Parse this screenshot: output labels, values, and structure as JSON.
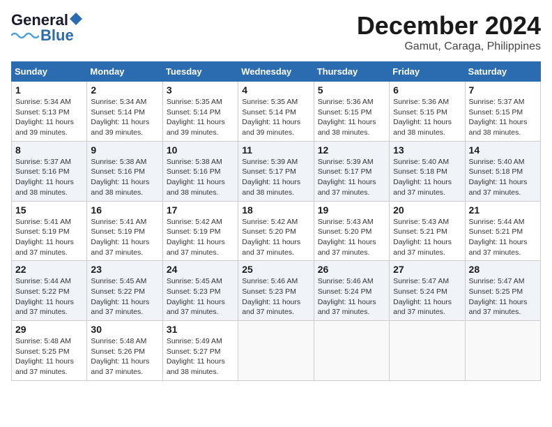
{
  "logo": {
    "line1": "General",
    "line2": "Blue"
  },
  "header": {
    "month": "December 2024",
    "location": "Gamut, Caraga, Philippines"
  },
  "columns": [
    "Sunday",
    "Monday",
    "Tuesday",
    "Wednesday",
    "Thursday",
    "Friday",
    "Saturday"
  ],
  "weeks": [
    [
      {
        "day": "1",
        "sunrise": "5:34 AM",
        "sunset": "5:13 PM",
        "daylight": "11 hours and 39 minutes."
      },
      {
        "day": "2",
        "sunrise": "5:34 AM",
        "sunset": "5:14 PM",
        "daylight": "11 hours and 39 minutes."
      },
      {
        "day": "3",
        "sunrise": "5:35 AM",
        "sunset": "5:14 PM",
        "daylight": "11 hours and 39 minutes."
      },
      {
        "day": "4",
        "sunrise": "5:35 AM",
        "sunset": "5:14 PM",
        "daylight": "11 hours and 39 minutes."
      },
      {
        "day": "5",
        "sunrise": "5:36 AM",
        "sunset": "5:15 PM",
        "daylight": "11 hours and 38 minutes."
      },
      {
        "day": "6",
        "sunrise": "5:36 AM",
        "sunset": "5:15 PM",
        "daylight": "11 hours and 38 minutes."
      },
      {
        "day": "7",
        "sunrise": "5:37 AM",
        "sunset": "5:15 PM",
        "daylight": "11 hours and 38 minutes."
      }
    ],
    [
      {
        "day": "8",
        "sunrise": "5:37 AM",
        "sunset": "5:16 PM",
        "daylight": "11 hours and 38 minutes."
      },
      {
        "day": "9",
        "sunrise": "5:38 AM",
        "sunset": "5:16 PM",
        "daylight": "11 hours and 38 minutes."
      },
      {
        "day": "10",
        "sunrise": "5:38 AM",
        "sunset": "5:16 PM",
        "daylight": "11 hours and 38 minutes."
      },
      {
        "day": "11",
        "sunrise": "5:39 AM",
        "sunset": "5:17 PM",
        "daylight": "11 hours and 38 minutes."
      },
      {
        "day": "12",
        "sunrise": "5:39 AM",
        "sunset": "5:17 PM",
        "daylight": "11 hours and 37 minutes."
      },
      {
        "day": "13",
        "sunrise": "5:40 AM",
        "sunset": "5:18 PM",
        "daylight": "11 hours and 37 minutes."
      },
      {
        "day": "14",
        "sunrise": "5:40 AM",
        "sunset": "5:18 PM",
        "daylight": "11 hours and 37 minutes."
      }
    ],
    [
      {
        "day": "15",
        "sunrise": "5:41 AM",
        "sunset": "5:19 PM",
        "daylight": "11 hours and 37 minutes."
      },
      {
        "day": "16",
        "sunrise": "5:41 AM",
        "sunset": "5:19 PM",
        "daylight": "11 hours and 37 minutes."
      },
      {
        "day": "17",
        "sunrise": "5:42 AM",
        "sunset": "5:19 PM",
        "daylight": "11 hours and 37 minutes."
      },
      {
        "day": "18",
        "sunrise": "5:42 AM",
        "sunset": "5:20 PM",
        "daylight": "11 hours and 37 minutes."
      },
      {
        "day": "19",
        "sunrise": "5:43 AM",
        "sunset": "5:20 PM",
        "daylight": "11 hours and 37 minutes."
      },
      {
        "day": "20",
        "sunrise": "5:43 AM",
        "sunset": "5:21 PM",
        "daylight": "11 hours and 37 minutes."
      },
      {
        "day": "21",
        "sunrise": "5:44 AM",
        "sunset": "5:21 PM",
        "daylight": "11 hours and 37 minutes."
      }
    ],
    [
      {
        "day": "22",
        "sunrise": "5:44 AM",
        "sunset": "5:22 PM",
        "daylight": "11 hours and 37 minutes."
      },
      {
        "day": "23",
        "sunrise": "5:45 AM",
        "sunset": "5:22 PM",
        "daylight": "11 hours and 37 minutes."
      },
      {
        "day": "24",
        "sunrise": "5:45 AM",
        "sunset": "5:23 PM",
        "daylight": "11 hours and 37 minutes."
      },
      {
        "day": "25",
        "sunrise": "5:46 AM",
        "sunset": "5:23 PM",
        "daylight": "11 hours and 37 minutes."
      },
      {
        "day": "26",
        "sunrise": "5:46 AM",
        "sunset": "5:24 PM",
        "daylight": "11 hours and 37 minutes."
      },
      {
        "day": "27",
        "sunrise": "5:47 AM",
        "sunset": "5:24 PM",
        "daylight": "11 hours and 37 minutes."
      },
      {
        "day": "28",
        "sunrise": "5:47 AM",
        "sunset": "5:25 PM",
        "daylight": "11 hours and 37 minutes."
      }
    ],
    [
      {
        "day": "29",
        "sunrise": "5:48 AM",
        "sunset": "5:25 PM",
        "daylight": "11 hours and 37 minutes."
      },
      {
        "day": "30",
        "sunrise": "5:48 AM",
        "sunset": "5:26 PM",
        "daylight": "11 hours and 37 minutes."
      },
      {
        "day": "31",
        "sunrise": "5:49 AM",
        "sunset": "5:27 PM",
        "daylight": "11 hours and 38 minutes."
      },
      null,
      null,
      null,
      null
    ]
  ],
  "labels": {
    "sunrise": "Sunrise:",
    "sunset": "Sunset:",
    "daylight": "Daylight:"
  }
}
